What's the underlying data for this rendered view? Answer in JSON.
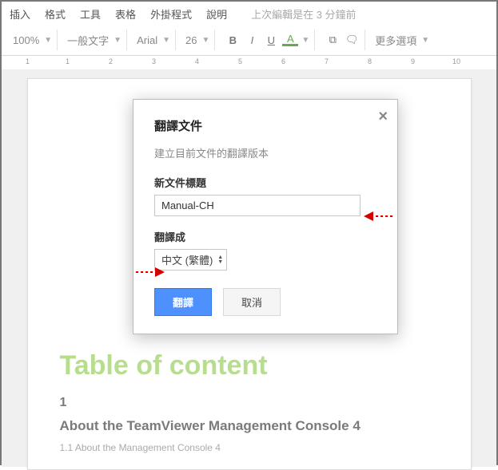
{
  "menubar": {
    "items": [
      "插入",
      "格式",
      "工具",
      "表格",
      "外掛程式",
      "說明"
    ],
    "status": "上次編輯是在 3 分鐘前"
  },
  "toolbar": {
    "zoom": "100%",
    "style": "一般文字",
    "font": "Arial",
    "size": "26",
    "bold": "B",
    "italic": "I",
    "underline": "U",
    "textcolor": "A",
    "link": "⧉",
    "comment": "🗨",
    "more": "更多選項"
  },
  "ruler": {
    "marks": [
      "1",
      "",
      "1",
      "",
      "2",
      "",
      "3",
      "",
      "4",
      "",
      "5",
      "",
      "6",
      "",
      "7",
      "",
      "8",
      "",
      "9",
      "",
      "10"
    ]
  },
  "document": {
    "title": "Table of content",
    "section_num": "1",
    "heading": "About the TeamViewer Management Console 4",
    "sub": "1.1 About the Management Console 4"
  },
  "dialog": {
    "title": "翻譯文件",
    "desc": "建立目前文件的翻譯版本",
    "label_title": "新文件標題",
    "input_value": "Manual-CH",
    "label_lang": "翻譯成",
    "lang_value": "中文 (繁體)",
    "btn_translate": "翻譯",
    "btn_cancel": "取消",
    "close": "×"
  }
}
